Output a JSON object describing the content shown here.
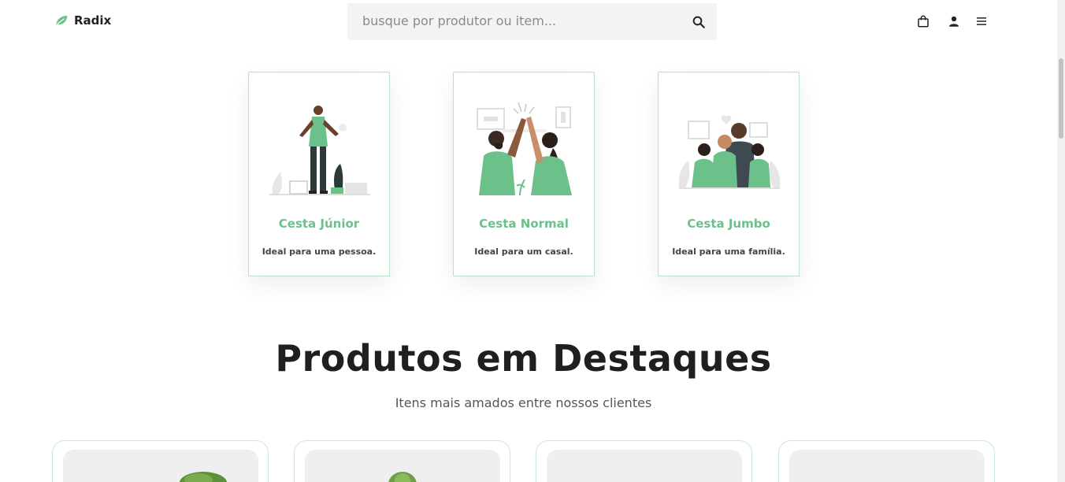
{
  "header": {
    "brand": "Radix",
    "search_placeholder": "busque por produtor ou item...",
    "icons": [
      "leaf-icon",
      "search-icon",
      "bag-icon",
      "user-icon",
      "menu-icon"
    ]
  },
  "baskets": [
    {
      "title": "Cesta Júnior",
      "description": "Ideal para uma pessoa."
    },
    {
      "title": "Cesta Normal",
      "description": "Ideal para um casal."
    },
    {
      "title": "Cesta Jumbo",
      "description": "Ideal para uma família."
    }
  ],
  "featured": {
    "title": "Produtos em Destaques",
    "subtitle": "Itens mais amados entre nossos clientes"
  },
  "colors": {
    "accent": "#6cc08a",
    "card_border": "#b8e2c5",
    "search_bg": "#f3f3f3"
  }
}
